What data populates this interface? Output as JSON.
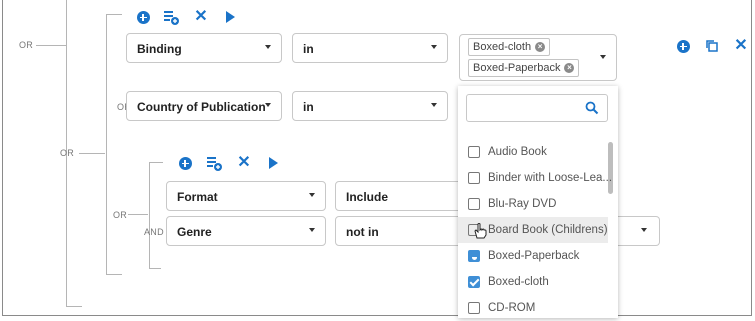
{
  "operators": {
    "or_top": "OR",
    "or_country": "OR",
    "or_middle": "OR",
    "or_bottom": "OR",
    "and_genre": "AND"
  },
  "group1": {
    "rows": [
      {
        "field": "Binding",
        "condition": "in"
      },
      {
        "field": "Country of Publication",
        "condition": "in"
      }
    ],
    "binding_values": [
      "Boxed-cloth",
      "Boxed-Paperback"
    ]
  },
  "group2": {
    "rows": [
      {
        "field": "Format",
        "condition": "Include"
      },
      {
        "field": "Genre",
        "condition": "not in"
      }
    ]
  },
  "dropdown": {
    "options": [
      {
        "label": "Audio Book",
        "state": "unchecked"
      },
      {
        "label": "Binder with Loose-Lea...",
        "state": "unchecked"
      },
      {
        "label": "Blu-Ray DVD",
        "state": "unchecked"
      },
      {
        "label": "Board Book (Childrens)",
        "state": "hover"
      },
      {
        "label": "Boxed-Paperback",
        "state": "checked-partial"
      },
      {
        "label": "Boxed-cloth",
        "state": "checked"
      },
      {
        "label": "CD-ROM",
        "state": "unchecked"
      }
    ]
  },
  "icons": [
    "add-circle-icon",
    "add-list-icon",
    "close-icon",
    "play-icon",
    "copy-icon",
    "search-icon",
    "clear-chip-icon"
  ],
  "colors": {
    "accent": "#1a73c8",
    "checkbox": "#3f8fd6"
  }
}
